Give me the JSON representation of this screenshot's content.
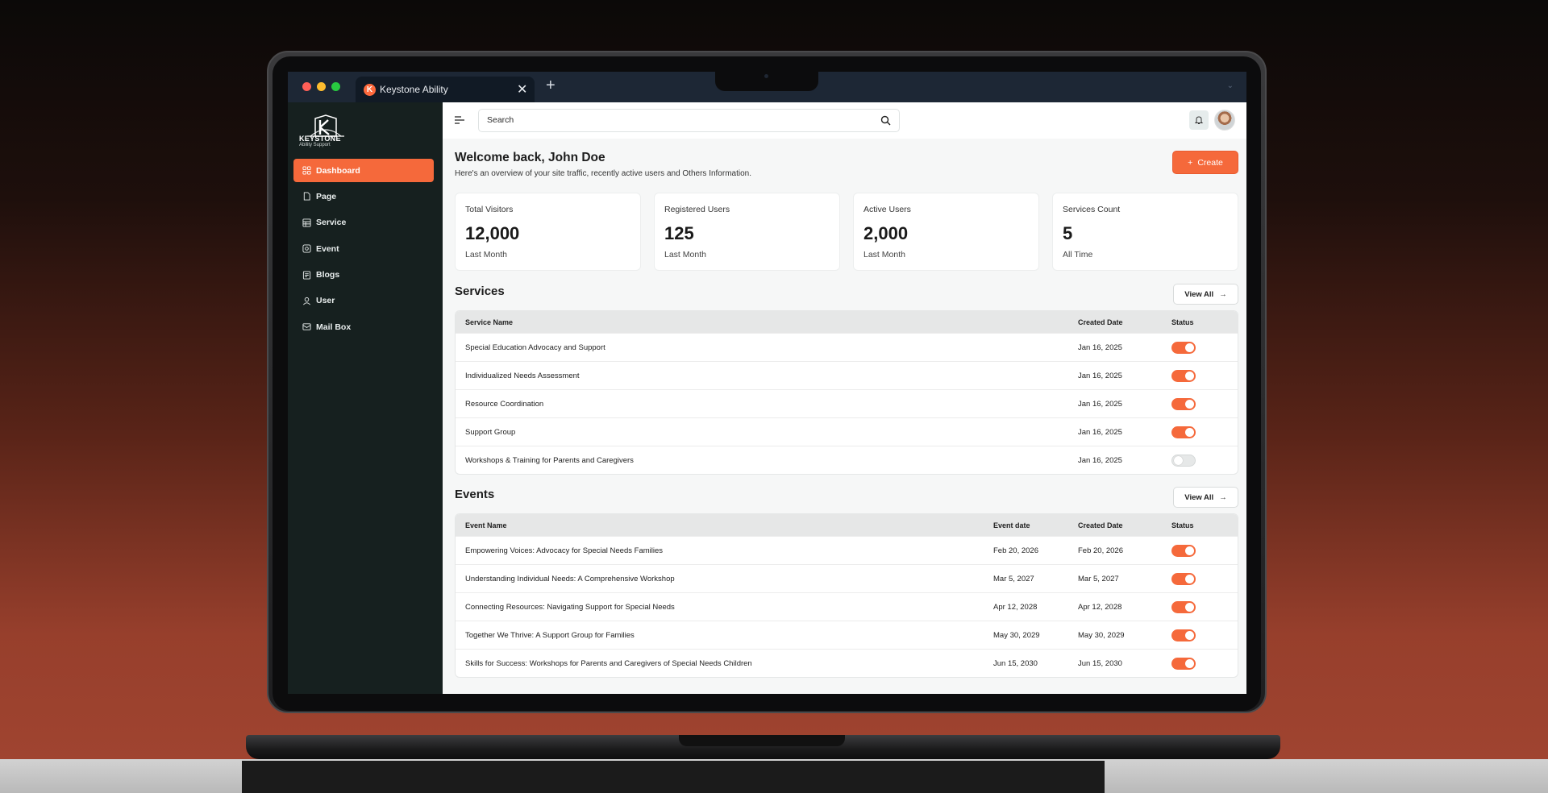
{
  "browser": {
    "tab_title": "Keystone Ability",
    "tab_logo_letter": "K",
    "new_tab_symbol": "+",
    "close_symbol": "✕"
  },
  "brand": {
    "name": "KEYSTONE",
    "tagline": "Ability Support",
    "accent_color": "#f5693b"
  },
  "sidebar": {
    "items": [
      {
        "label": "Dashboard",
        "icon": "dashboard-icon",
        "active": true
      },
      {
        "label": "Page",
        "icon": "page-icon",
        "active": false
      },
      {
        "label": "Service",
        "icon": "service-icon",
        "active": false
      },
      {
        "label": "Event",
        "icon": "event-icon",
        "active": false
      },
      {
        "label": "Blogs",
        "icon": "blogs-icon",
        "active": false
      },
      {
        "label": "User",
        "icon": "user-icon",
        "active": false
      },
      {
        "label": "Mail Box",
        "icon": "mail-icon",
        "active": false
      }
    ]
  },
  "topbar": {
    "search_placeholder": "Search"
  },
  "welcome": {
    "title": "Welcome back, John Doe",
    "subtitle": "Here's an overview of your site traffic, recently active users and Others Information.",
    "create_label": "Create"
  },
  "stats": [
    {
      "label": "Total Visitors",
      "value": "12,000",
      "period": "Last Month"
    },
    {
      "label": "Registered Users",
      "value": "125",
      "period": "Last Month"
    },
    {
      "label": "Active Users",
      "value": "2,000",
      "period": "Last Month"
    },
    {
      "label": "Services Count",
      "value": "5",
      "period": "All Time"
    }
  ],
  "services": {
    "title": "Services",
    "view_all": "View All",
    "columns": [
      "Service Name",
      "Created Date",
      "Status"
    ],
    "rows": [
      {
        "name": "Special Education Advocacy and Support",
        "created": "Jan 16, 2025",
        "status": true
      },
      {
        "name": "Individualized Needs Assessment",
        "created": "Jan 16, 2025",
        "status": true
      },
      {
        "name": "Resource Coordination",
        "created": "Jan 16, 2025",
        "status": true
      },
      {
        "name": "Support Group",
        "created": "Jan 16, 2025",
        "status": true
      },
      {
        "name": "Workshops & Training for Parents and Caregivers",
        "created": "Jan 16, 2025",
        "status": false
      }
    ]
  },
  "events": {
    "title": "Events",
    "view_all": "View All",
    "columns": [
      "Event Name",
      "Event date",
      "Created Date",
      "Status"
    ],
    "rows": [
      {
        "name": "Empowering Voices: Advocacy for Special Needs Families",
        "event_date": "Feb 20, 2026",
        "created": "Feb 20, 2026",
        "status": true
      },
      {
        "name": "Understanding Individual Needs: A Comprehensive Workshop",
        "event_date": "Mar 5, 2027",
        "created": "Mar 5, 2027",
        "status": true
      },
      {
        "name": "Connecting Resources: Navigating Support for Special Needs",
        "event_date": "Apr 12, 2028",
        "created": "Apr 12, 2028",
        "status": true
      },
      {
        "name": "Together We Thrive: A Support Group for Families",
        "event_date": "May 30, 2029",
        "created": "May 30, 2029",
        "status": true
      },
      {
        "name": "Skills for Success: Workshops for Parents and Caregivers of Special Needs Children",
        "event_date": "Jun 15, 2030",
        "created": "Jun 15, 2030",
        "status": true
      }
    ]
  }
}
